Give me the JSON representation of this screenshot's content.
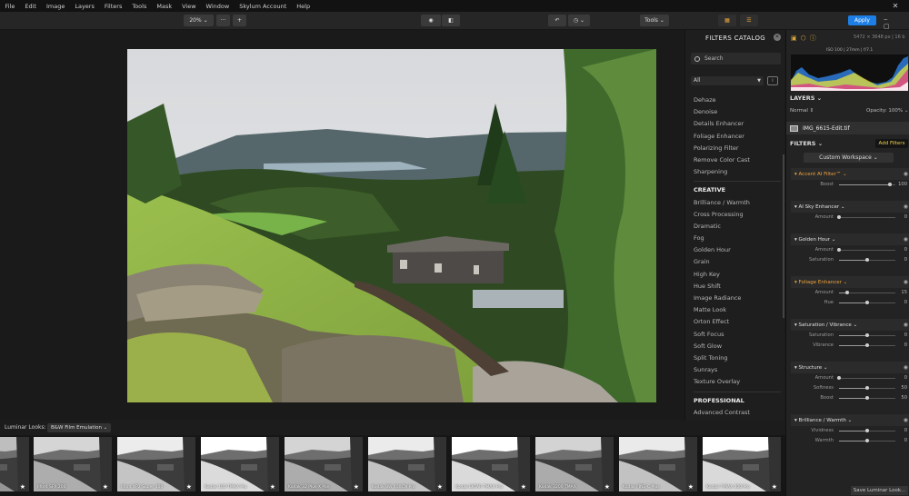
{
  "menu": [
    "File",
    "Edit",
    "Image",
    "Layers",
    "Filters",
    "Tools",
    "Mask",
    "View",
    "Window",
    "Skylum Account",
    "Help"
  ],
  "toolbar": {
    "zoom": "20%",
    "zoom_more": "···",
    "zoom_plus": "+",
    "tools": "Tools",
    "apply": "Apply"
  },
  "catalog": {
    "title": "FILTERS CATALOG",
    "search_placeholder": "Search",
    "category": "All",
    "items_top": [
      "Dehaze",
      "Denoise",
      "Details Enhancer",
      "Foliage Enhancer",
      "Polarizing Filter",
      "Remove Color Cast",
      "Sharpening"
    ],
    "creative_title": "CREATIVE",
    "creative_items": [
      "Brilliance / Warmth",
      "Cross Processing",
      "Dramatic",
      "Fog",
      "Golden Hour",
      "Grain",
      "High Key",
      "Hue Shift",
      "Image Radiance",
      "Matte Look",
      "Orton Effect",
      "Soft Focus",
      "Soft Glow",
      "Split Toning",
      "Sunrays",
      "Texture Overlay"
    ],
    "professional_title": "PROFESSIONAL",
    "professional_items": [
      "Advanced Contrast"
    ]
  },
  "histogram": {
    "dims": "5472 × 3648 px | 16 b",
    "meta": "ISO 100 | 27mm | f/7.1"
  },
  "layers": {
    "title": "LAYERS",
    "blend": "Normal",
    "opacity": "Opacity: 100%",
    "layer_name": "IMG_6615-Edit.tif"
  },
  "filters": {
    "title": "FILTERS",
    "add_button": "Add Filters",
    "workspace": "Custom Workspace",
    "groups": [
      {
        "name": "Accent AI Filter™",
        "orange": true,
        "sliders": [
          {
            "label": "Boost",
            "value": "100",
            "pos": 0.9
          }
        ]
      },
      {
        "name": "AI Sky Enhancer",
        "orange": false,
        "sliders": [
          {
            "label": "Amount",
            "value": "0",
            "pos": 0.0
          }
        ]
      },
      {
        "name": "Golden Hour",
        "orange": false,
        "sliders": [
          {
            "label": "Amount",
            "value": "0",
            "pos": 0.0
          },
          {
            "label": "Saturation",
            "value": "0",
            "pos": 0.5
          }
        ]
      },
      {
        "name": "Foliage Enhancer",
        "orange": true,
        "sliders": [
          {
            "label": "Amount",
            "value": "15",
            "pos": 0.15
          },
          {
            "label": "Hue",
            "value": "0",
            "pos": 0.5
          }
        ]
      },
      {
        "name": "Saturation / Vibrance",
        "orange": false,
        "sliders": [
          {
            "label": "Saturation",
            "value": "0",
            "pos": 0.5
          },
          {
            "label": "Vibrance",
            "value": "0",
            "pos": 0.5
          }
        ]
      },
      {
        "name": "Structure",
        "orange": false,
        "sliders": [
          {
            "label": "Amount",
            "value": "0",
            "pos": 0.0
          },
          {
            "label": "Softness",
            "value": "50",
            "pos": 0.5
          },
          {
            "label": "Boost",
            "value": "50",
            "pos": 0.5
          }
        ]
      },
      {
        "name": "Brilliance / Warmth",
        "orange": false,
        "sliders": [
          {
            "label": "Vividness",
            "value": "0",
            "pos": 0.5
          },
          {
            "label": "Warmth",
            "value": "0",
            "pos": 0.5
          }
        ]
      }
    ],
    "save_looks": "Save Luminar Look..."
  },
  "looks": {
    "label": "Luminar Looks:",
    "selected": "B&W Film Emulation",
    "thumbs": [
      "Ilford FP4 Plus 50",
      "Ilford SFX 200",
      "Ilford XP2 Super 400",
      "Kodak 100 TMAX Pro",
      "Kodak 32 Plus-X Pan",
      "Kodak BW 400CN Pro",
      "Kodak EKTAR TMAX Pro",
      "Kodak 3200 TMAX",
      "Kodak FINE-C Plus",
      "Kodak T-MAX 400 Pro"
    ]
  }
}
